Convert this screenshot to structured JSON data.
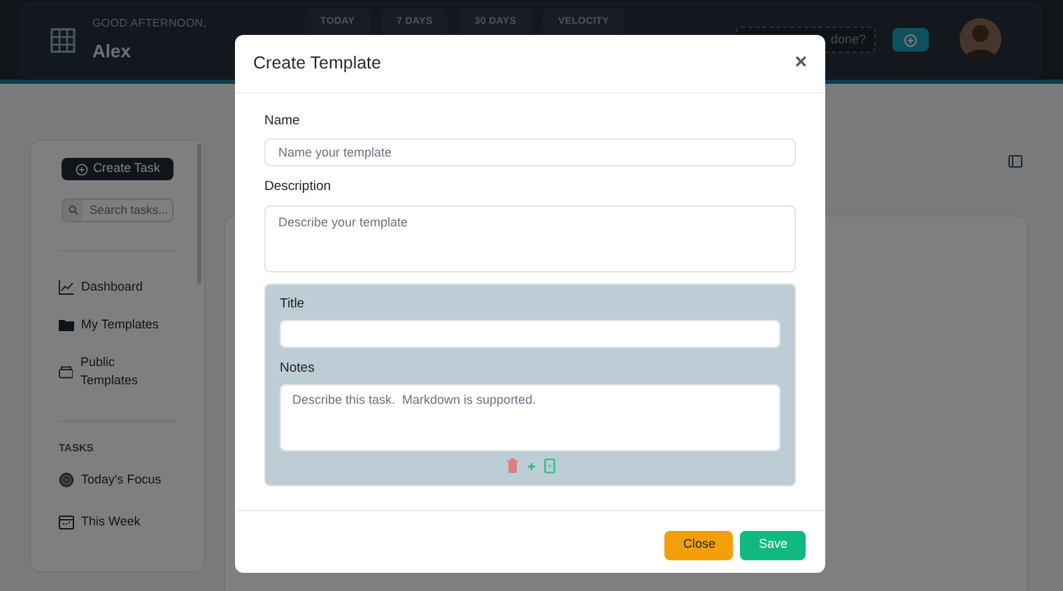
{
  "header": {
    "greeting": "GOOD AFTERNOON,",
    "user": "Alex",
    "tabs": [
      {
        "label": "TODAY",
        "selected": false
      },
      {
        "label": "7 DAYS",
        "selected": false
      },
      {
        "label": "30 DAYS",
        "selected": false
      },
      {
        "label": "VELOCITY",
        "selected": false
      }
    ],
    "quick_add": {
      "placeholder": "done?"
    }
  },
  "sidebar": {
    "create_button": "Create Task",
    "search": {
      "placeholder": "Search tasks..."
    },
    "items": [
      {
        "label": "Dashboard",
        "kind": "chart"
      },
      {
        "label": "My Templates",
        "kind": "folder"
      },
      {
        "label": "Public Templates",
        "kind": "tray"
      }
    ],
    "section": "TASKS",
    "task_items": [
      {
        "label": "Today's Focus",
        "kind": "target"
      },
      {
        "label": "This Week",
        "kind": "calendar"
      }
    ]
  },
  "modal": {
    "title": "Create Template",
    "close": "×",
    "name": {
      "label": "Name",
      "placeholder": "Name your template"
    },
    "description": {
      "label": "Description",
      "placeholder": "Describe your template"
    },
    "task": {
      "title_label": "Title",
      "notes_label": "Notes",
      "notes_placeholder": "Describe this task.  Markdown is supported."
    },
    "buttons": [
      {
        "label": "Close",
        "kind": "secondary"
      },
      {
        "label": "Save",
        "kind": "primary"
      }
    ]
  }
}
